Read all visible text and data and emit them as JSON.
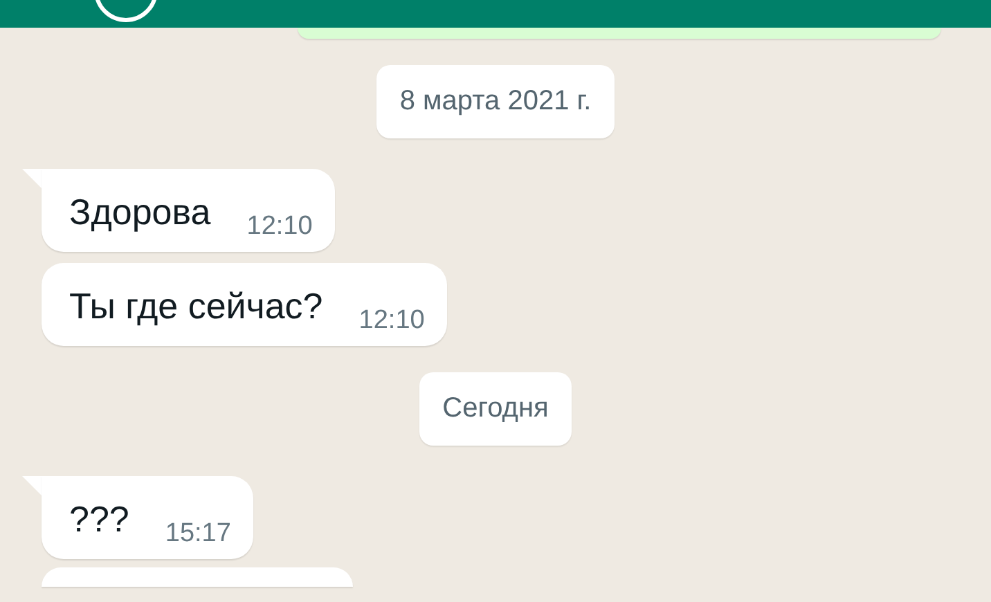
{
  "header": {
    "avatar": true
  },
  "messages": [
    {
      "kind": "outgoing"
    },
    {
      "kind": "date",
      "text": "8 марта 2021 г."
    },
    {
      "kind": "incoming",
      "tail": true,
      "text": "Здорова",
      "time": "12:10"
    },
    {
      "kind": "incoming",
      "tail": false,
      "text": "Ты где сейчас?",
      "time": "12:10"
    },
    {
      "kind": "date",
      "text": "Сегодня"
    },
    {
      "kind": "incoming",
      "tail": true,
      "text": "???",
      "time": "15:17"
    },
    {
      "kind": "incoming",
      "tail": false
    }
  ]
}
